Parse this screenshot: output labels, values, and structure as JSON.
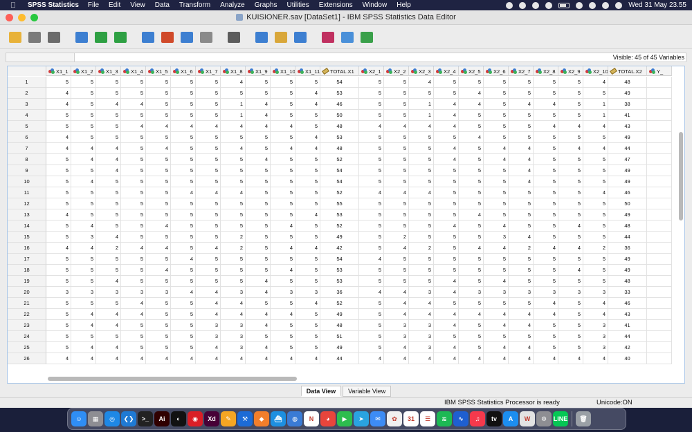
{
  "menubar": {
    "app_name": "SPSS Statistics",
    "items": [
      "File",
      "Edit",
      "View",
      "Data",
      "Transform",
      "Analyze",
      "Graphs",
      "Utilities",
      "Extensions",
      "Window",
      "Help"
    ],
    "clock": "Wed 31 May  23.55"
  },
  "window": {
    "title": "KUISIONER.sav [DataSet1] - IBM SPSS Statistics Data Editor"
  },
  "toolbar": {
    "icons": [
      "open-icon",
      "save-icon",
      "print-icon",
      "recall-dialog-icon",
      "undo-icon",
      "redo-icon",
      "goto-case-icon",
      "goto-variable-icon",
      "variables-icon",
      "run-descriptives-icon",
      "find-icon",
      "insert-cases-icon",
      "insert-variable-icon",
      "split-file-icon",
      "value-labels-icon",
      "use-sets-icon",
      "spelling-icon"
    ]
  },
  "refbar": {
    "visible_text": "Visible: 45 of 45 Variables"
  },
  "grid": {
    "columns": [
      {
        "name": "X1_1",
        "type": "nominal"
      },
      {
        "name": "X1_2",
        "type": "nominal"
      },
      {
        "name": "X1_3",
        "type": "nominal"
      },
      {
        "name": "X1_4",
        "type": "nominal"
      },
      {
        "name": "X1_5",
        "type": "nominal"
      },
      {
        "name": "X1_6",
        "type": "nominal"
      },
      {
        "name": "X1_7",
        "type": "nominal"
      },
      {
        "name": "X1_8",
        "type": "nominal"
      },
      {
        "name": "X1_9",
        "type": "nominal"
      },
      {
        "name": "X1_10",
        "type": "nominal"
      },
      {
        "name": "X1_11",
        "type": "nominal"
      },
      {
        "name": "TOTAL.X1",
        "type": "scale"
      },
      {
        "name": "X2_1",
        "type": "nominal"
      },
      {
        "name": "X2_2",
        "type": "nominal"
      },
      {
        "name": "X2_3",
        "type": "nominal"
      },
      {
        "name": "X2_4",
        "type": "nominal"
      },
      {
        "name": "X2_5",
        "type": "nominal"
      },
      {
        "name": "X2_6",
        "type": "nominal"
      },
      {
        "name": "X2_7",
        "type": "nominal"
      },
      {
        "name": "X2_8",
        "type": "nominal"
      },
      {
        "name": "X2_9",
        "type": "nominal"
      },
      {
        "name": "X2_10",
        "type": "nominal"
      },
      {
        "name": "TOTAL.X2",
        "type": "scale"
      },
      {
        "name": "Y_",
        "type": "nominal"
      }
    ],
    "rows": [
      [
        5,
        5,
        5,
        5,
        5,
        5,
        5,
        4,
        5,
        5,
        5,
        54,
        5,
        5,
        4,
        5,
        5,
        5,
        5,
        5,
        5,
        4,
        48,
        ""
      ],
      [
        4,
        5,
        5,
        5,
        5,
        5,
        5,
        5,
        5,
        5,
        4,
        53,
        5,
        5,
        5,
        5,
        4,
        5,
        5,
        5,
        5,
        5,
        49,
        ""
      ],
      [
        4,
        5,
        4,
        4,
        5,
        5,
        5,
        1,
        4,
        5,
        4,
        46,
        5,
        5,
        1,
        4,
        4,
        5,
        4,
        4,
        5,
        1,
        38,
        ""
      ],
      [
        5,
        5,
        5,
        5,
        5,
        5,
        5,
        1,
        4,
        5,
        5,
        50,
        5,
        5,
        1,
        4,
        5,
        5,
        5,
        5,
        5,
        1,
        41,
        ""
      ],
      [
        5,
        5,
        5,
        4,
        4,
        4,
        4,
        4,
        4,
        4,
        5,
        48,
        4,
        4,
        4,
        4,
        5,
        5,
        5,
        4,
        4,
        4,
        43,
        ""
      ],
      [
        4,
        5,
        5,
        5,
        5,
        5,
        5,
        5,
        5,
        5,
        4,
        53,
        5,
        5,
        5,
        5,
        4,
        5,
        5,
        5,
        5,
        5,
        49,
        ""
      ],
      [
        4,
        4,
        4,
        5,
        4,
        5,
        5,
        4,
        5,
        4,
        4,
        48,
        5,
        5,
        5,
        4,
        5,
        4,
        4,
        5,
        4,
        4,
        44,
        ""
      ],
      [
        5,
        4,
        4,
        5,
        5,
        5,
        5,
        5,
        4,
        5,
        5,
        52,
        5,
        5,
        5,
        4,
        5,
        4,
        4,
        5,
        5,
        5,
        47,
        ""
      ],
      [
        5,
        5,
        4,
        5,
        5,
        5,
        5,
        5,
        5,
        5,
        5,
        54,
        5,
        5,
        5,
        5,
        5,
        5,
        4,
        5,
        5,
        5,
        49,
        ""
      ],
      [
        5,
        4,
        5,
        5,
        5,
        5,
        5,
        5,
        5,
        5,
        5,
        54,
        5,
        5,
        5,
        5,
        5,
        5,
        4,
        5,
        5,
        5,
        49,
        ""
      ],
      [
        5,
        5,
        5,
        5,
        5,
        4,
        4,
        4,
        5,
        5,
        5,
        52,
        4,
        4,
        4,
        5,
        5,
        5,
        5,
        5,
        5,
        4,
        46,
        ""
      ],
      [
        5,
        5,
        5,
        5,
        5,
        5,
        5,
        5,
        5,
        5,
        5,
        55,
        5,
        5,
        5,
        5,
        5,
        5,
        5,
        5,
        5,
        5,
        50,
        ""
      ],
      [
        4,
        5,
        5,
        5,
        5,
        5,
        5,
        5,
        5,
        5,
        4,
        53,
        5,
        5,
        5,
        5,
        4,
        5,
        5,
        5,
        5,
        5,
        49,
        ""
      ],
      [
        5,
        4,
        5,
        5,
        4,
        5,
        5,
        5,
        5,
        4,
        5,
        52,
        5,
        5,
        5,
        4,
        5,
        4,
        5,
        5,
        4,
        5,
        48,
        ""
      ],
      [
        5,
        3,
        4,
        5,
        5,
        5,
        5,
        2,
        5,
        5,
        5,
        49,
        5,
        2,
        5,
        5,
        5,
        3,
        4,
        5,
        5,
        5,
        44,
        ""
      ],
      [
        4,
        4,
        2,
        4,
        4,
        5,
        4,
        2,
        5,
        4,
        4,
        42,
        5,
        4,
        2,
        5,
        4,
        4,
        2,
        4,
        4,
        2,
        36,
        ""
      ],
      [
        5,
        5,
        5,
        5,
        5,
        4,
        5,
        5,
        5,
        5,
        5,
        54,
        4,
        5,
        5,
        5,
        5,
        5,
        5,
        5,
        5,
        5,
        49,
        ""
      ],
      [
        5,
        5,
        5,
        5,
        4,
        5,
        5,
        5,
        5,
        4,
        5,
        53,
        5,
        5,
        5,
        5,
        5,
        5,
        5,
        5,
        4,
        5,
        49,
        ""
      ],
      [
        5,
        5,
        4,
        5,
        5,
        5,
        5,
        5,
        4,
        5,
        5,
        53,
        5,
        5,
        5,
        4,
        5,
        4,
        5,
        5,
        5,
        5,
        48,
        ""
      ],
      [
        3,
        3,
        3,
        3,
        3,
        4,
        4,
        3,
        4,
        3,
        3,
        36,
        4,
        4,
        3,
        4,
        3,
        3,
        3,
        3,
        3,
        3,
        33,
        ""
      ],
      [
        5,
        5,
        5,
        4,
        5,
        5,
        4,
        4,
        5,
        5,
        4,
        52,
        5,
        4,
        4,
        5,
        5,
        5,
        5,
        4,
        5,
        4,
        46,
        ""
      ],
      [
        5,
        4,
        4,
        4,
        5,
        5,
        4,
        4,
        4,
        4,
        5,
        49,
        5,
        4,
        4,
        4,
        4,
        4,
        4,
        4,
        5,
        4,
        43,
        ""
      ],
      [
        5,
        4,
        4,
        5,
        5,
        5,
        3,
        3,
        4,
        5,
        5,
        48,
        5,
        3,
        3,
        4,
        5,
        4,
        4,
        5,
        5,
        3,
        41,
        ""
      ],
      [
        5,
        5,
        5,
        5,
        5,
        5,
        3,
        3,
        5,
        5,
        5,
        51,
        5,
        3,
        3,
        5,
        5,
        5,
        5,
        5,
        5,
        3,
        44,
        ""
      ],
      [
        5,
        4,
        4,
        5,
        5,
        5,
        4,
        3,
        4,
        5,
        5,
        49,
        5,
        4,
        3,
        4,
        5,
        4,
        4,
        5,
        5,
        3,
        42,
        ""
      ],
      [
        4,
        4,
        4,
        4,
        4,
        4,
        4,
        4,
        4,
        4,
        4,
        44,
        4,
        4,
        4,
        4,
        4,
        4,
        4,
        4,
        4,
        4,
        40,
        ""
      ]
    ]
  },
  "view_tabs": [
    {
      "label": "Data View",
      "active": true
    },
    {
      "label": "Variable View",
      "active": false
    }
  ],
  "status": {
    "processor": "IBM SPSS Statistics Processor is ready",
    "unicode": "Unicode:ON"
  },
  "dock": {
    "apps": [
      {
        "name": "finder-icon",
        "color": "#2f8ef5",
        "glyph": "☺"
      },
      {
        "name": "launchpad-icon",
        "color": "#8e8e93",
        "glyph": "▦"
      },
      {
        "name": "safari-icon",
        "color": "#1e88e5",
        "glyph": "◎"
      },
      {
        "name": "vscode-icon",
        "color": "#1f7ad4",
        "glyph": "❮❯"
      },
      {
        "name": "terminal-icon",
        "color": "#222222",
        "glyph": ">_"
      },
      {
        "name": "illustrator-icon",
        "color": "#300000",
        "glyph": "Ai"
      },
      {
        "name": "figma-icon",
        "color": "#111111",
        "glyph": "◐"
      },
      {
        "name": "creative-cloud-icon",
        "color": "#da1f26",
        "glyph": "◉"
      },
      {
        "name": "xd-icon",
        "color": "#470137",
        "glyph": "Xd"
      },
      {
        "name": "pages-icon",
        "color": "#f5a623",
        "glyph": "✎"
      },
      {
        "name": "xcode-icon",
        "color": "#1c6bd6",
        "glyph": "⚒"
      },
      {
        "name": "sketch-icon",
        "color": "#f27e2b",
        "glyph": "◆"
      },
      {
        "name": "docker-icon",
        "color": "#1d8fe0",
        "glyph": "⛴"
      },
      {
        "name": "network-icon",
        "color": "#3a7bd5",
        "glyph": "◍"
      },
      {
        "name": "notion-icon",
        "color": "#ffffff",
        "glyph": "N"
      },
      {
        "name": "chrome-icon",
        "color": "#e8453c",
        "glyph": "◕"
      },
      {
        "name": "facetime-icon",
        "color": "#2dbd4e",
        "glyph": "▶"
      },
      {
        "name": "telegram-icon",
        "color": "#2aa3e0",
        "glyph": "➤"
      },
      {
        "name": "mail-icon",
        "color": "#3d8cf5",
        "glyph": "✉"
      },
      {
        "name": "photos-icon",
        "color": "#f0f0f0",
        "glyph": "✿"
      },
      {
        "name": "calendar-icon",
        "color": "#ffffff",
        "glyph": "31"
      },
      {
        "name": "reminders-icon",
        "color": "#ffffff",
        "glyph": "☰"
      },
      {
        "name": "spotify-icon",
        "color": "#1db954",
        "glyph": "≋"
      },
      {
        "name": "stocks-icon",
        "color": "#1e5fd0",
        "glyph": "∿"
      },
      {
        "name": "music-icon",
        "color": "#f5394c",
        "glyph": "♫"
      },
      {
        "name": "appletv-icon",
        "color": "#111111",
        "glyph": "tv"
      },
      {
        "name": "appstore-icon",
        "color": "#1c8ef0",
        "glyph": "A"
      },
      {
        "name": "word-icon",
        "color": "#e3e3e3",
        "glyph": "W"
      },
      {
        "name": "system-settings-icon",
        "color": "#8e8e93",
        "glyph": "⚙"
      },
      {
        "name": "line-icon",
        "color": "#06c755",
        "glyph": "LINE"
      },
      {
        "name": "trash-icon",
        "color": "#9aa0a6",
        "glyph": "🗑"
      }
    ]
  },
  "colors": {
    "grid_border": "#a9c6e8",
    "header_bg": "#f3f3f3"
  }
}
